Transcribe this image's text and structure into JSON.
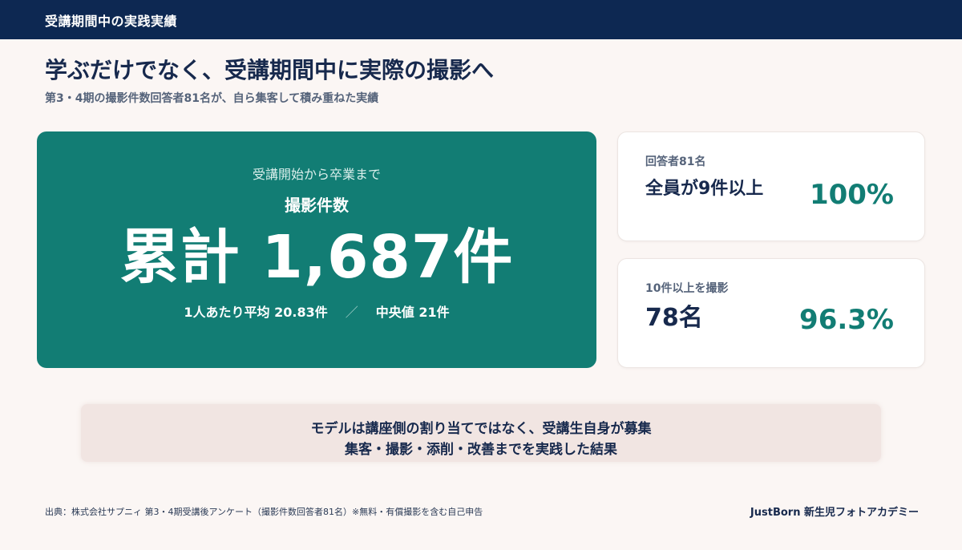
{
  "header": {
    "title": "受講期間中の実践実績"
  },
  "headline": "学ぶだけでなく、受講期間中に実際の撮影へ",
  "subheadline": "第3・4期の撮影件数回答者81名が、自ら集客して積み重ねた実績",
  "main_card": {
    "period": "受講開始から卒業まで",
    "label": "撮影件数",
    "total": "累計 1,687件",
    "average": "1人あたり平均 20.83件",
    "separator": "／",
    "median": "中央値 21件"
  },
  "stat_cards": [
    {
      "label": "回答者81名",
      "value": "全員が9件以上",
      "percent": "100%"
    },
    {
      "label": "10件以上を撮影",
      "value": "78名",
      "percent": "96.3%"
    }
  ],
  "banner": {
    "line1": "モデルは講座側の割り当てではなく、受講生自身が募集",
    "line2": "集客・撮影・添削・改善までを実践した結果"
  },
  "footer": {
    "source": "出典：株式会社サプニィ 第3・4期受講後アンケート（撮影件数回答者81名）※無料・有償撮影を含む自己申告",
    "brand": "JustBorn 新生児フォトアカデミー"
  },
  "colors": {
    "navy": "#0d2852",
    "teal": "#127d74",
    "background": "#fbf6f4",
    "banner": "#f1e5e2"
  }
}
